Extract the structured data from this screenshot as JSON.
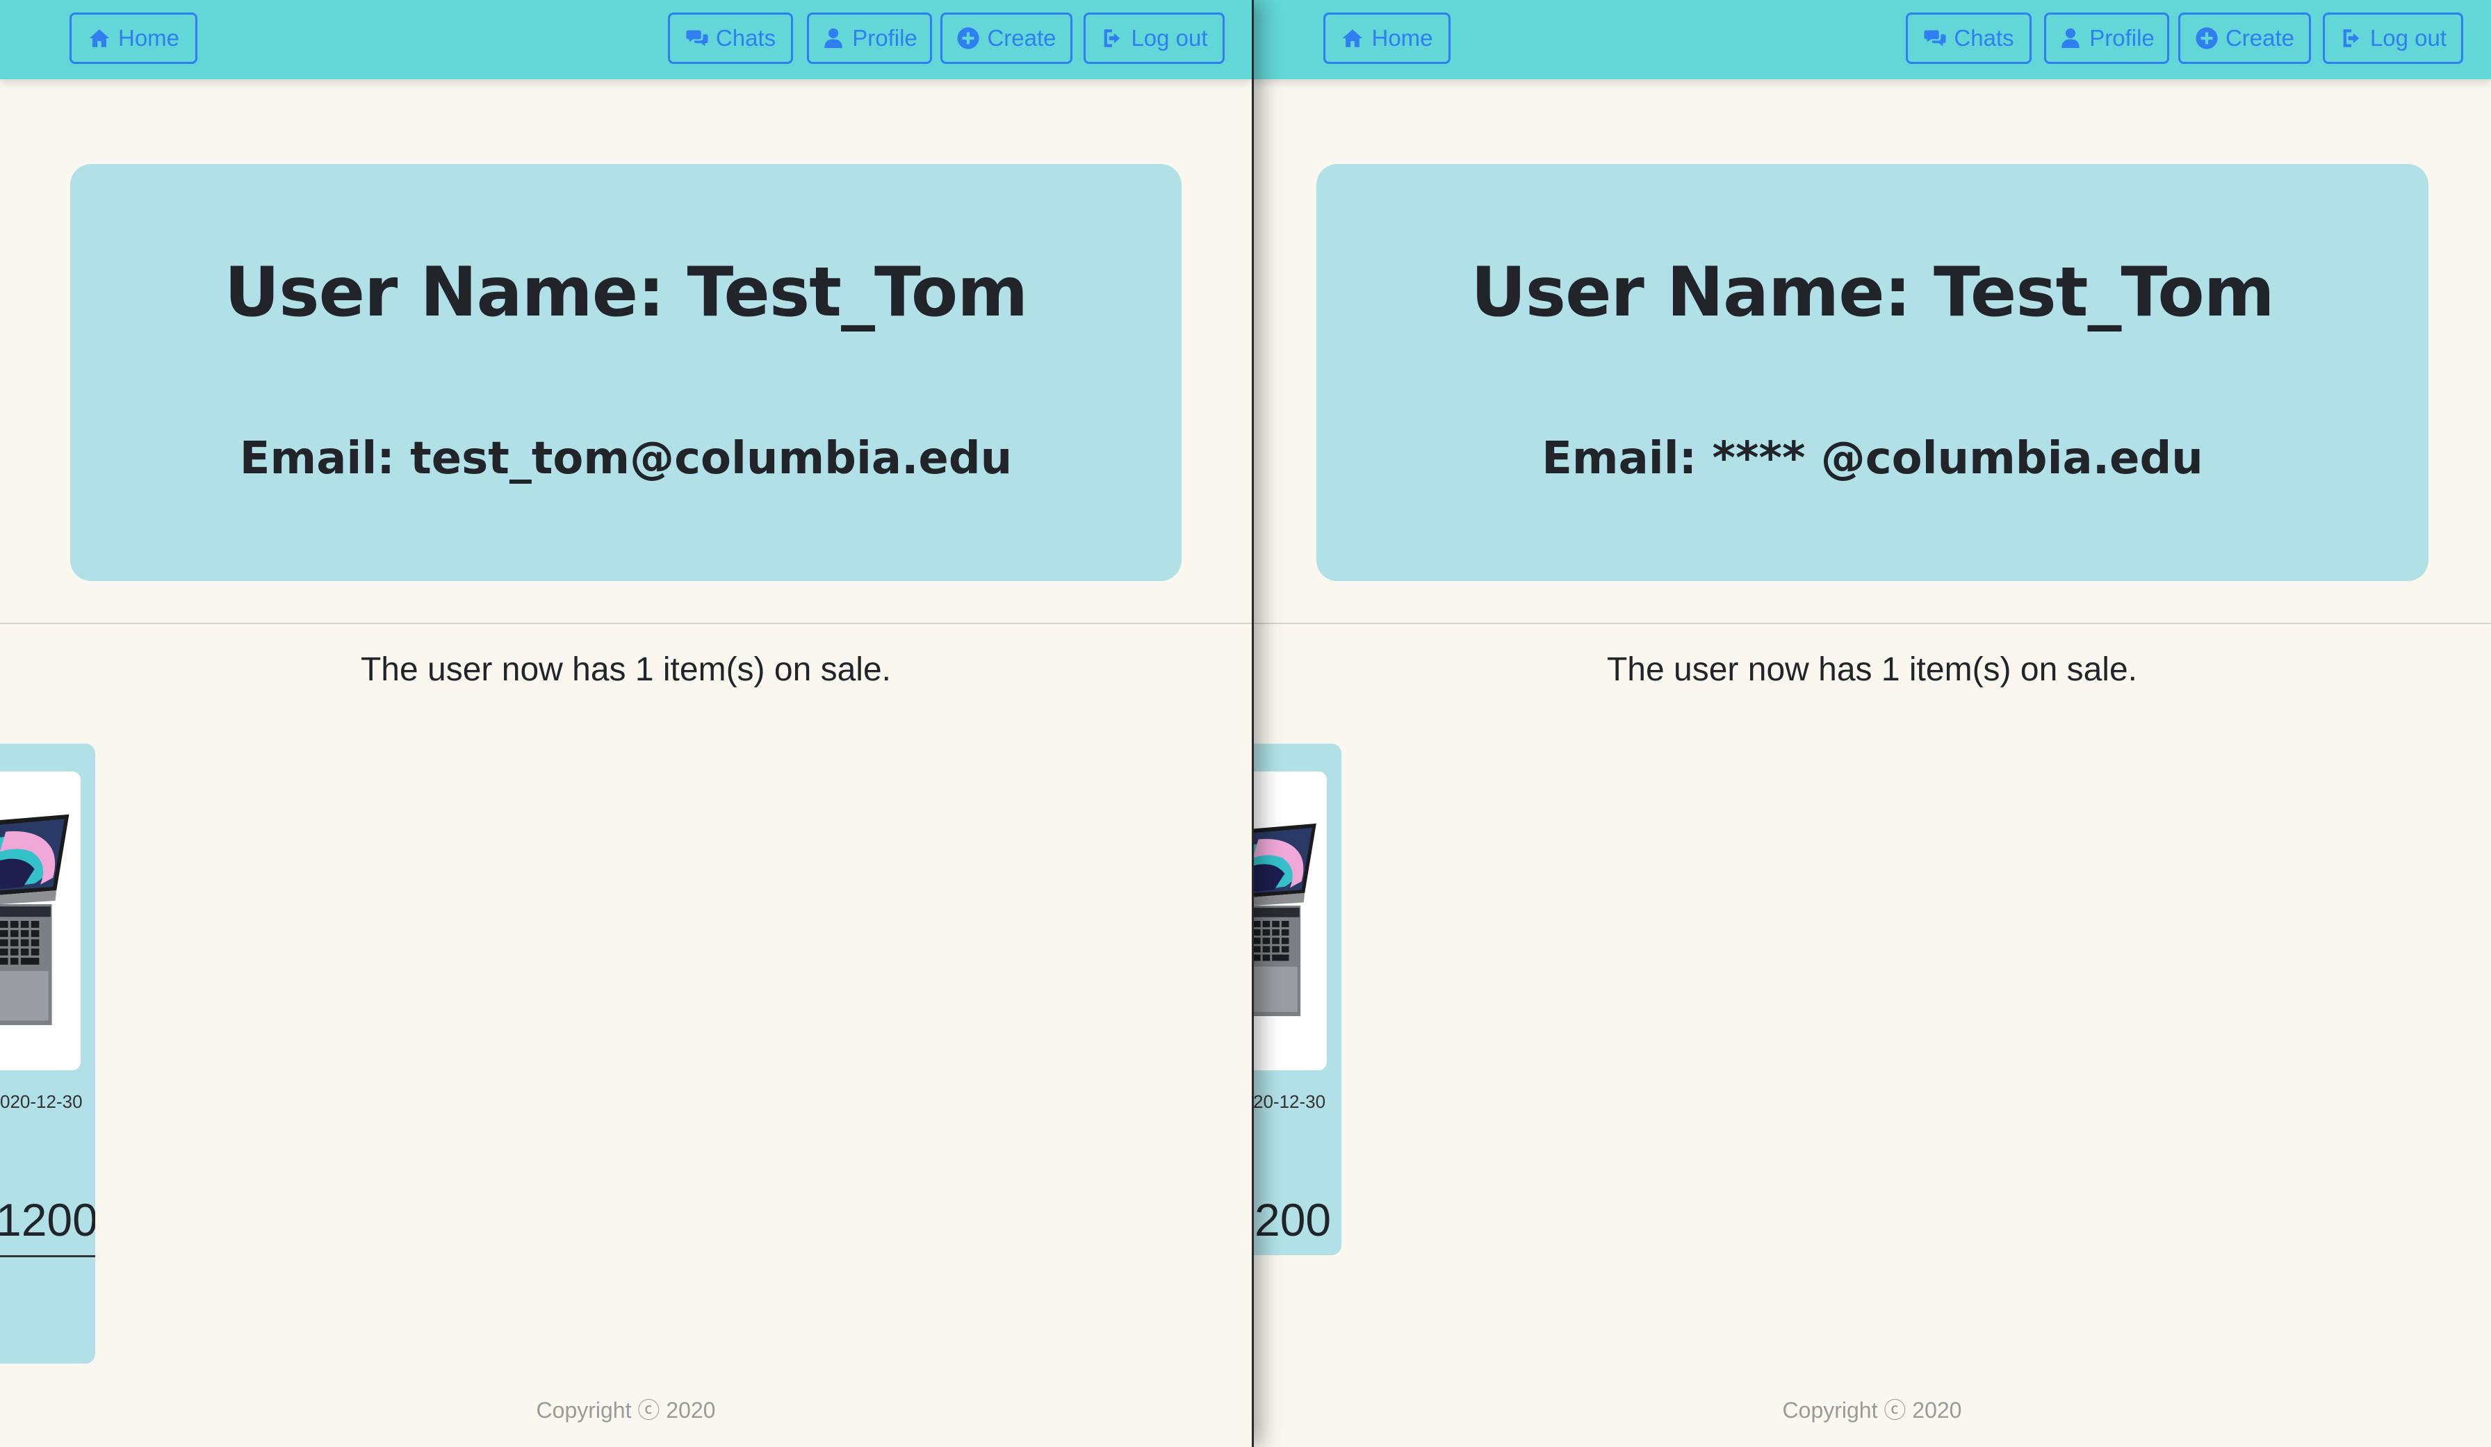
{
  "nav": {
    "home": "Home",
    "chats": "Chats",
    "profile": "Profile",
    "create": "Create",
    "logout": "Log out"
  },
  "left": {
    "user_name": "User Name: Test_Tom",
    "email": "Email: test_tom@columbia.edu",
    "items_count": "The user now has 1 item(s) on sale.",
    "item": {
      "date": "020-12-30",
      "price": "1200"
    }
  },
  "right": {
    "user_name": "User Name: Test_Tom",
    "email": "Email: **** @columbia.edu",
    "items_count": "The user now has 1 item(s) on sale.",
    "item": {
      "date": "20-12-30",
      "price": "200"
    }
  },
  "copyright": "Copyright ⓒ 2020",
  "icons": {
    "home": "home-icon",
    "chats": "chat-bubbles-icon",
    "profile": "user-icon",
    "create": "plus-circle-icon",
    "logout": "sign-out-icon"
  },
  "colors": {
    "navbar": "#63d7d8",
    "button_accent": "#2f7ff0",
    "card": "#b1e1e6",
    "page_bg": "#faf8ee",
    "text": "#212529"
  }
}
